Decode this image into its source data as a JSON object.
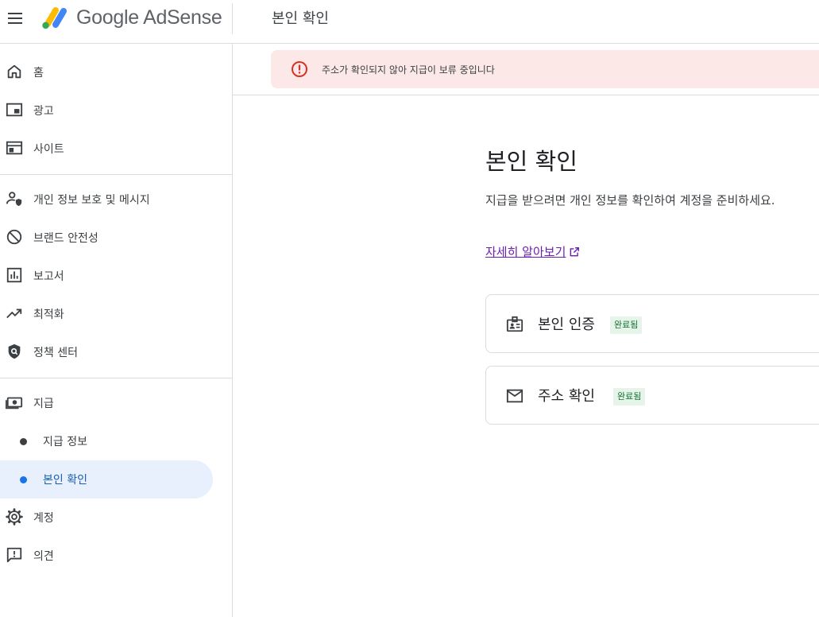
{
  "header": {
    "logo_text": "Google AdSense",
    "title": "본인 확인"
  },
  "sidebar": {
    "items": [
      {
        "label": "홈",
        "icon": "home-icon"
      },
      {
        "label": "광고",
        "icon": "ads-icon"
      },
      {
        "label": "사이트",
        "icon": "sites-icon"
      },
      {
        "label": "개인 정보 보호 및 메시지",
        "icon": "privacy-messaging-icon"
      },
      {
        "label": "브랜드 안전성",
        "icon": "brand-safety-icon"
      },
      {
        "label": "보고서",
        "icon": "reports-icon"
      },
      {
        "label": "최적화",
        "icon": "optimization-icon"
      },
      {
        "label": "정책 센터",
        "icon": "policy-center-icon"
      },
      {
        "label": "지급",
        "icon": "payments-icon"
      },
      {
        "label": "지급 정보",
        "icon": "bullet-icon"
      },
      {
        "label": "본인 확인",
        "icon": "bullet-icon"
      },
      {
        "label": "계정",
        "icon": "account-gear-icon"
      },
      {
        "label": "의견",
        "icon": "feedback-icon"
      }
    ]
  },
  "alert": {
    "message": "주소가 확인되지 않아 지급이 보류 중입니다",
    "icon": "error-icon",
    "color": "#fce8e6"
  },
  "main": {
    "heading": "본인 확인",
    "description": "지급을 받으려면 개인 정보를 확인하여 계정을 준비하세요.",
    "learn_more": "자세히 알아보기",
    "cards": [
      {
        "title": "본인 인증",
        "status": "완료됨",
        "icon": "id-badge-icon"
      },
      {
        "title": "주소 확인",
        "status": "완료됨",
        "icon": "mail-icon"
      }
    ]
  },
  "colors": {
    "accent": "#1a73e8",
    "active_nav_bg": "#e8f0fe",
    "badge_bg": "#e6f4ea",
    "badge_text": "#137333",
    "error": "#d93025",
    "link": "#6a1fb2"
  }
}
